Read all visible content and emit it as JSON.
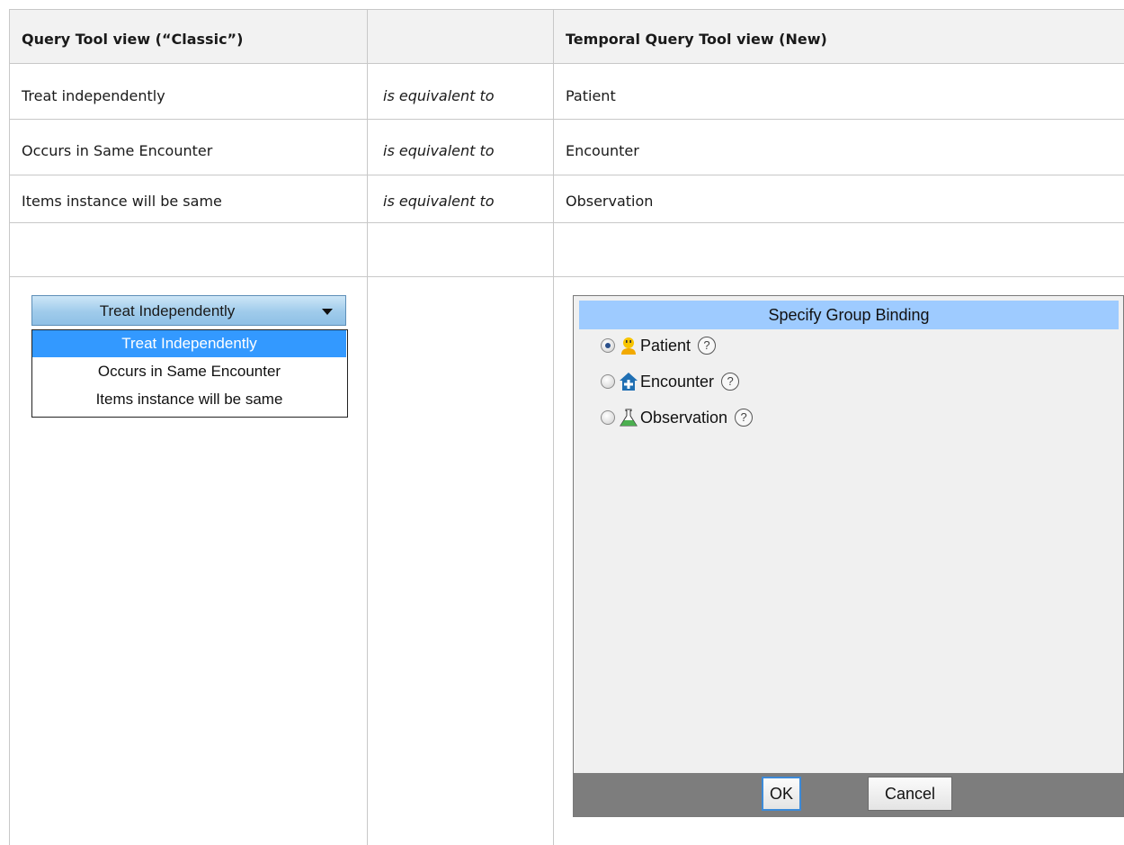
{
  "table": {
    "headers": [
      "Query Tool view (“Classic”)",
      "",
      "Temporal Query Tool view (New)"
    ],
    "rows": [
      {
        "classic": "Treat independently",
        "relation": "is equivalent to",
        "temporal": "Patient"
      },
      {
        "classic": "Occurs in Same Encounter",
        "relation": "is equivalent to",
        "temporal": "Encounter"
      },
      {
        "classic": "Items instance will be same",
        "relation": "is equivalent to",
        "temporal": "Observation"
      }
    ]
  },
  "classic_dropdown": {
    "selected": "Treat Independently",
    "options": [
      "Treat Independently",
      "Occurs in Same Encounter",
      "Items instance will be same"
    ]
  },
  "dialog": {
    "title": "Specify Group Binding",
    "options": [
      {
        "label": "Patient",
        "icon": "patient-icon",
        "checked": true
      },
      {
        "label": "Encounter",
        "icon": "encounter-icon",
        "checked": false
      },
      {
        "label": "Observation",
        "icon": "observation-icon",
        "checked": false
      }
    ],
    "help_glyph": "?",
    "ok_label": "OK",
    "cancel_label": "Cancel"
  },
  "colors": {
    "header_bg": "#f2f2f2",
    "selection": "#3399ff",
    "dialog_title_bg": "#9ecbff",
    "footer_bg": "#7d7d7d"
  }
}
